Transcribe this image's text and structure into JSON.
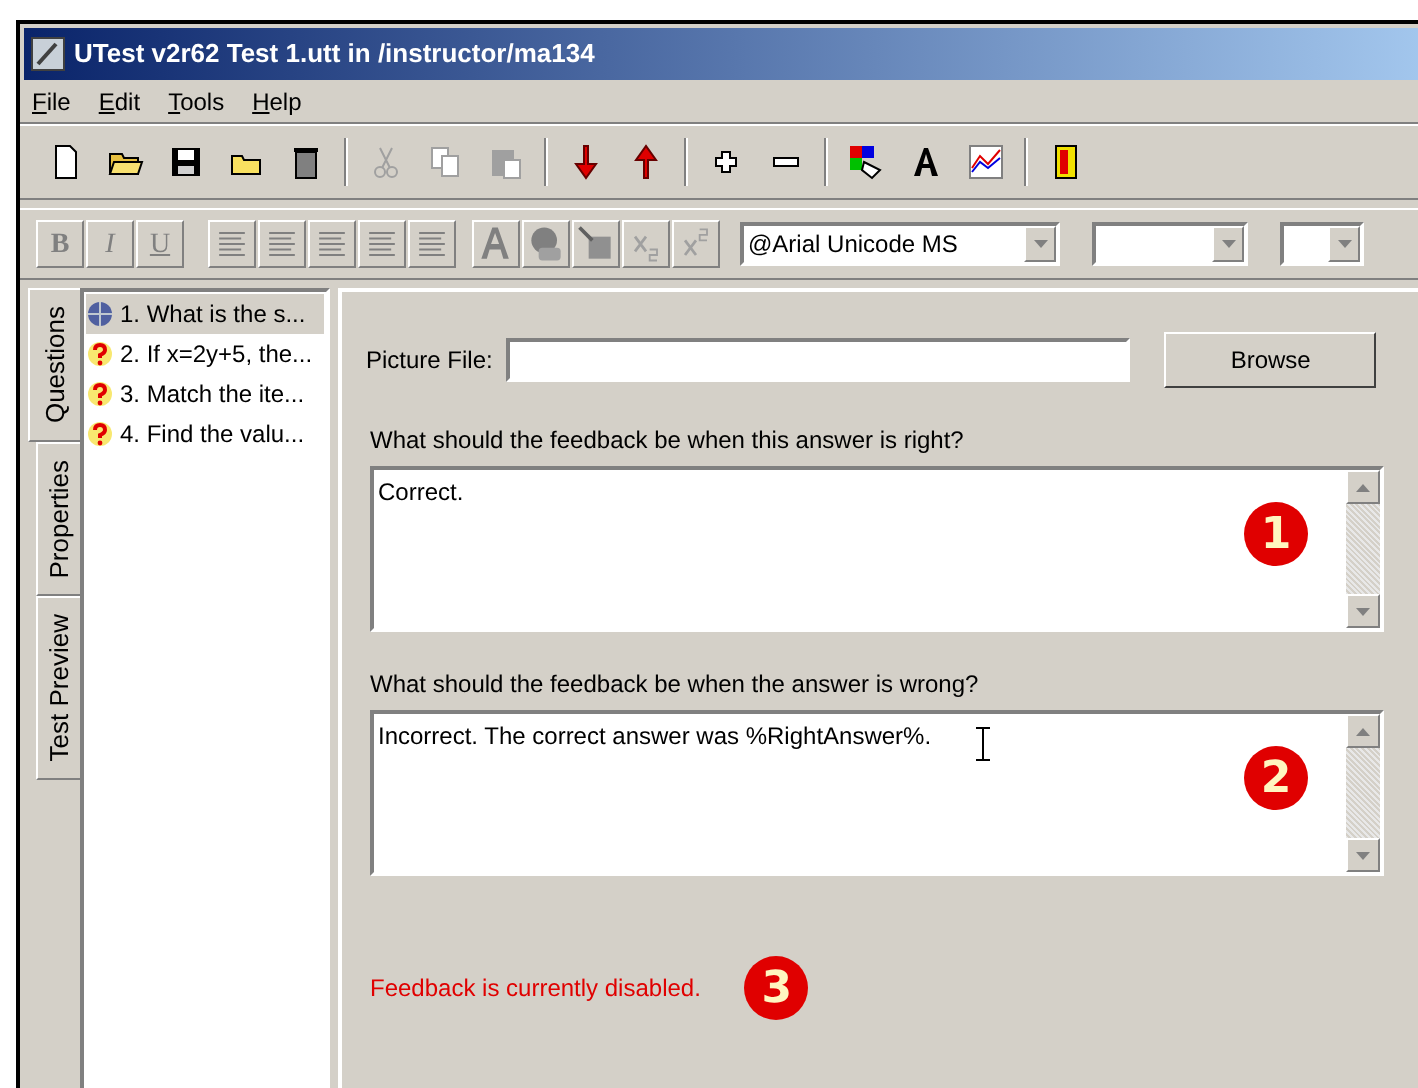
{
  "window": {
    "title": "UTest v2r62 Test 1.utt in /instructor/ma134"
  },
  "menu": [
    "File",
    "Edit",
    "Tools",
    "Help"
  ],
  "format_toolbar": {
    "buttons": [
      {
        "label": "B",
        "disabled": true
      },
      {
        "label": "I",
        "disabled": true
      },
      {
        "label": "U",
        "disabled": true
      }
    ],
    "font": "@Arial Unicode MS"
  },
  "side_tabs": [
    {
      "label": "Questions",
      "selected": true
    },
    {
      "label": "Properties",
      "selected": false
    },
    {
      "label": "Test Preview",
      "selected": false
    }
  ],
  "questions": [
    {
      "label": "1. What is the s...",
      "selected": true,
      "kind": "current"
    },
    {
      "label": "2. If x=2y+5, the...",
      "selected": false,
      "kind": "question"
    },
    {
      "label": "3. Match the ite...",
      "selected": false,
      "kind": "question"
    },
    {
      "label": "4. Find the valu...",
      "selected": false,
      "kind": "question"
    }
  ],
  "picture_file": {
    "label": "Picture File:",
    "button": "Browse"
  },
  "feedback": [
    {
      "label": "What should the feedback be when this answer is right?",
      "value": "Correct.",
      "callout": "1",
      "cursor": false
    },
    {
      "label": "What should the feedback be when the answer is wrong?",
      "value": "Incorrect. The correct answer was %RightAnswer%.",
      "callout": "2",
      "cursor": true
    }
  ],
  "status": {
    "text": "Feedback is currently disabled.",
    "callout": "3"
  }
}
